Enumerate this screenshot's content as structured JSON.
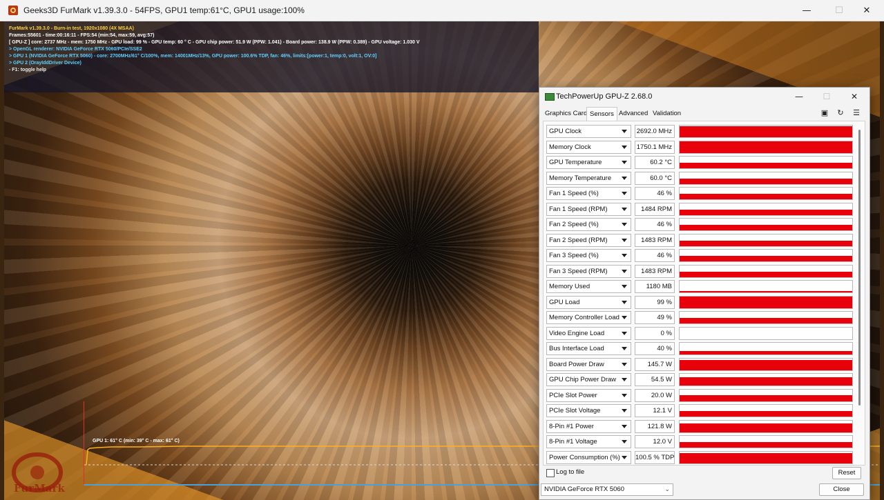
{
  "furmark": {
    "window_title": "Geeks3D FurMark v1.39.3.0 - 54FPS, GPU1 temp:61°C, GPU1 usage:100%",
    "window_buttons": {
      "minimize": "—",
      "maximize": "☐",
      "close": "✕"
    },
    "osd": {
      "line1": "FurMark v1.39.3.0 - Burn-in test, 1920x1080 (4X MSAA)",
      "line2": "Frames:55601 - time:00:16:11 - FPS:54 (min:54, max:59, avg:57)",
      "line3": "[ GPU-Z ] core: 2737 MHz - mem: 1750 MHz - GPU load: 99 % - GPU temp: 60 ° C - GPU chip power: 51.9 W (PPW: 1.041) - Board power: 138.9 W (PPW: 0.389) - GPU voltage: 1.030 V",
      "line4": "> OpenGL renderer: NVIDIA GeForce RTX 5060/PCIe/SSE2",
      "line5": "> GPU 1 (NVIDIA GeForce RTX 5060) - core: 2700MHz/61° C/100%, mem: 14001MHz/13%, GPU power: 100.6% TDP, fan: 46%, limits:[power:1, temp:0, volt:1, OV:0]",
      "line6": "> GPU 2 (OrayIddDriver Device)",
      "line7": "- F1: toggle help"
    },
    "graph_label": "GPU 1: 61° C (min: 39° C - max: 61° C)",
    "logo_text": "FurMark"
  },
  "gpuz": {
    "window_title": "TechPowerUp GPU-Z 2.68.0",
    "window_buttons": {
      "minimize": "—",
      "maximize": "☐",
      "close": "✕"
    },
    "tabs": [
      "Graphics Card",
      "Sensors",
      "Advanced",
      "Validation"
    ],
    "active_tab": "Sensors",
    "toolbar_icons": [
      "camera-icon",
      "refresh-icon",
      "menu-icon"
    ],
    "sensors": [
      {
        "name": "GPU Clock",
        "value": "2692.0 MHz",
        "level": 0.95
      },
      {
        "name": "Memory Clock",
        "value": "1750.1 MHz",
        "level": 0.95
      },
      {
        "name": "GPU Temperature",
        "value": "60.2 °C",
        "level": 0.45
      },
      {
        "name": "Memory Temperature",
        "value": "60.0 °C",
        "level": 0.45
      },
      {
        "name": "Fan 1 Speed (%)",
        "value": "46 %",
        "level": 0.46
      },
      {
        "name": "Fan 1 Speed (RPM)",
        "value": "1484 RPM",
        "level": 0.46
      },
      {
        "name": "Fan 2 Speed (%)",
        "value": "46 %",
        "level": 0.46
      },
      {
        "name": "Fan 2 Speed (RPM)",
        "value": "1483 RPM",
        "level": 0.46
      },
      {
        "name": "Fan 3 Speed (%)",
        "value": "46 %",
        "level": 0.46
      },
      {
        "name": "Fan 3 Speed (RPM)",
        "value": "1483 RPM",
        "level": 0.46
      },
      {
        "name": "Memory Used",
        "value": "1180 MB",
        "level": 0.14
      },
      {
        "name": "GPU Load",
        "value": "99 %",
        "level": 0.99
      },
      {
        "name": "Memory Controller Load",
        "value": "49 %",
        "level": 0.49
      },
      {
        "name": "Video Engine Load",
        "value": "0 %",
        "level": 0.0
      },
      {
        "name": "Bus Interface Load",
        "value": "40 %",
        "level": 0.3
      },
      {
        "name": "Board Power Draw",
        "value": "145.7 W",
        "level": 0.85
      },
      {
        "name": "GPU Chip Power Draw",
        "value": "54.5 W",
        "level": 0.7
      },
      {
        "name": "PCIe Slot Power",
        "value": "20.0 W",
        "level": 0.5
      },
      {
        "name": "PCIe Slot Voltage",
        "value": "12.1 V",
        "level": 0.5
      },
      {
        "name": "8-Pin #1 Power",
        "value": "121.8 W",
        "level": 0.75
      },
      {
        "name": "8-Pin #1 Voltage",
        "value": "12.0 V",
        "level": 0.5
      },
      {
        "name": "Power Consumption (%)",
        "value": "100.5 % TDP",
        "level": 0.85
      }
    ],
    "log_to_file_label": "Log to file",
    "reset_label": "Reset",
    "gpu_select": "NVIDIA GeForce RTX 5060",
    "close_label": "Close",
    "accent_color": "#e8000a"
  }
}
